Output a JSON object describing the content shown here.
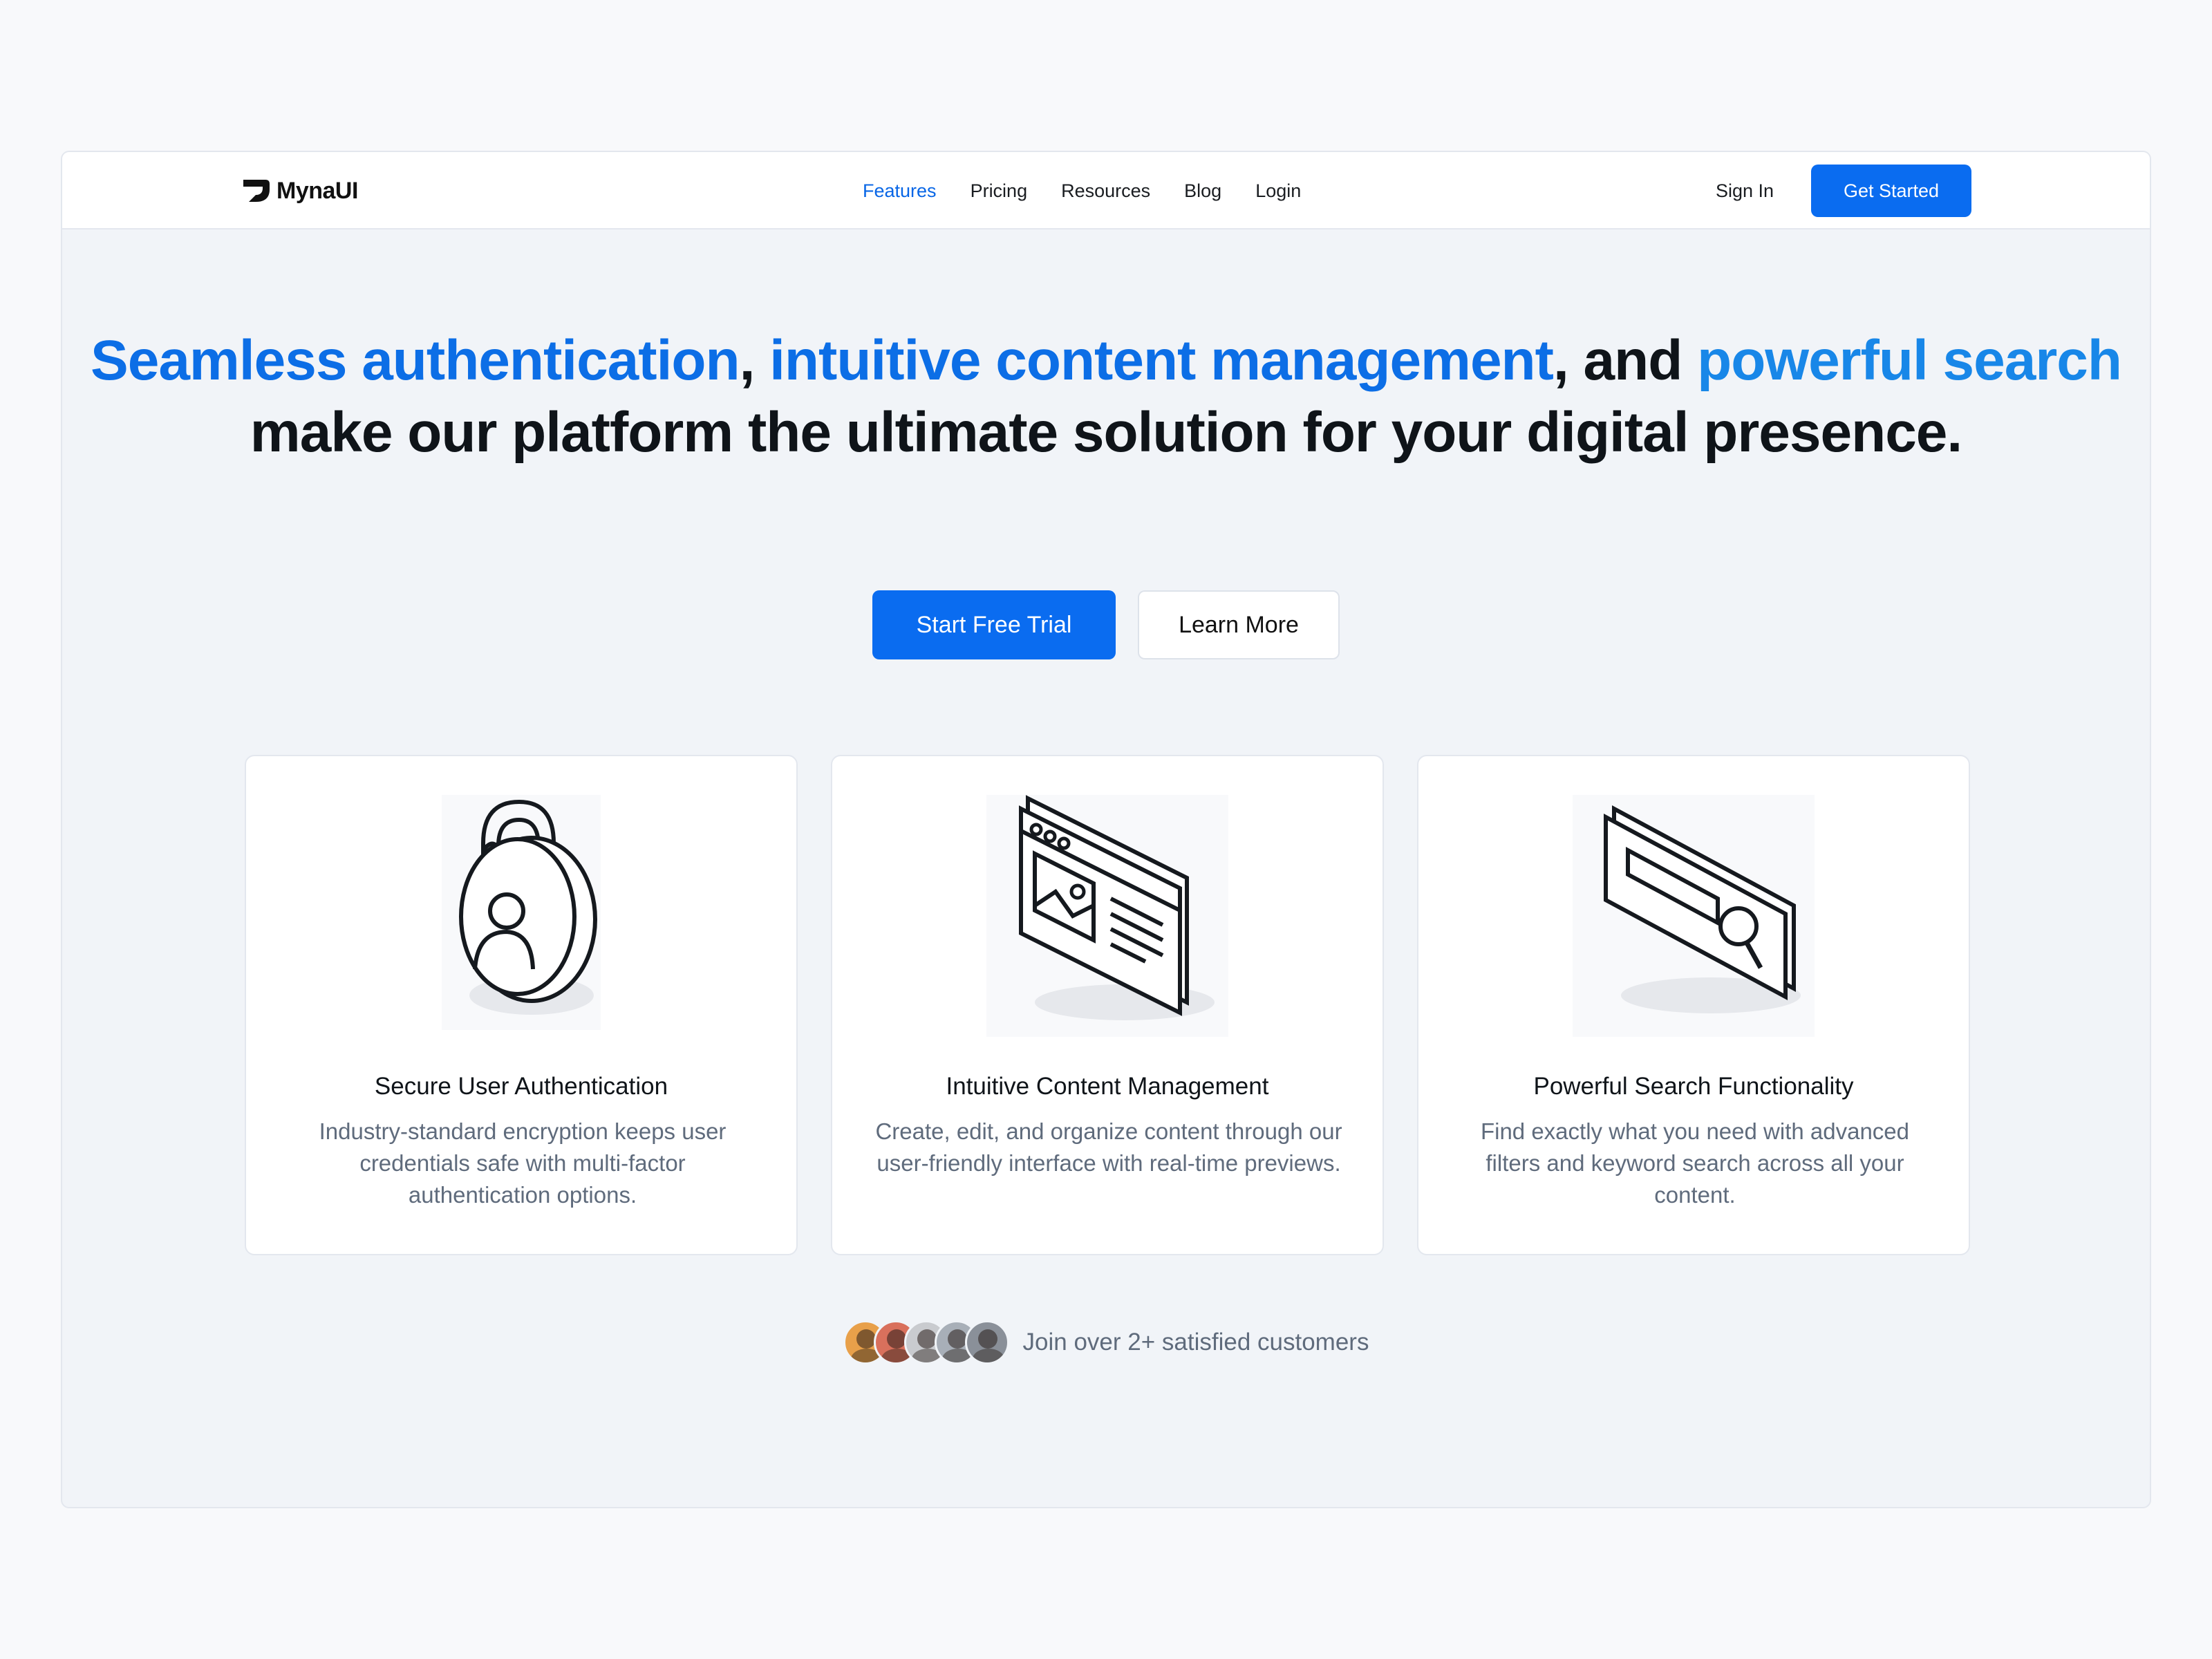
{
  "brand": {
    "name": "MynaUI"
  },
  "nav": {
    "links": [
      {
        "label": "Features",
        "active": true
      },
      {
        "label": "Pricing"
      },
      {
        "label": "Resources"
      },
      {
        "label": "Blog"
      },
      {
        "label": "Login"
      }
    ],
    "sign_in": "Sign In",
    "get_started": "Get Started"
  },
  "hero": {
    "part1": "Seamless authentication",
    "sep1": ", ",
    "part2": "intuitive content management",
    "sep2": ", and ",
    "part3": "powerful search",
    "part4": " make our platform the ultimate solution for your digital presence."
  },
  "cta": {
    "primary": "Start Free Trial",
    "secondary": "Learn More"
  },
  "features": [
    {
      "title": "Secure User Authentication",
      "description": "Industry-standard encryption keeps user credentials safe with multi-factor authentication options.",
      "icon": "padlock-user-icon"
    },
    {
      "title": "Intuitive Content Management",
      "description": "Create, edit, and organize content through our user-friendly interface with real-time previews.",
      "icon": "browser-window-icon"
    },
    {
      "title": "Powerful Search Functionality",
      "description": "Find exactly what you need with advanced filters and keyword search across all your content.",
      "icon": "search-bar-icon"
    }
  ],
  "social_proof": {
    "text": "Join over 2+ satisfied customers",
    "avatar_colors": [
      "#e8a04a",
      "#d9705c",
      "#c9cbcf",
      "#a8afb8",
      "#8a9099"
    ]
  },
  "colors": {
    "accent": "#0a6cf0",
    "headline_highlight": "#0c6ee6",
    "muted_text": "#5f6b7c"
  }
}
